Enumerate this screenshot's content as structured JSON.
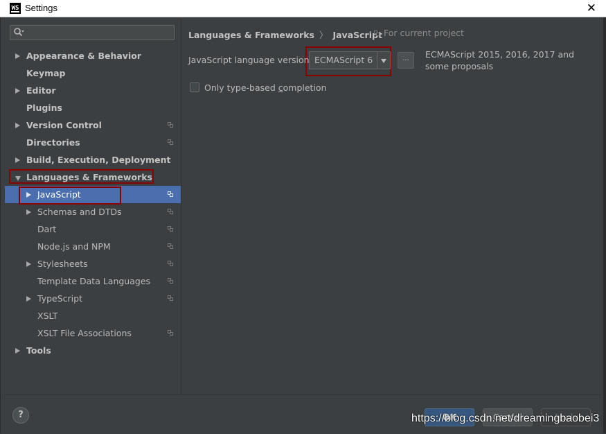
{
  "window": {
    "title": "Settings",
    "app_icon_text": "WS"
  },
  "search": {
    "placeholder": ""
  },
  "tree": [
    {
      "label": "Appearance & Behavior",
      "bold": true,
      "arrow": "right",
      "level": 0,
      "project": false
    },
    {
      "label": "Keymap",
      "bold": true,
      "arrow": "none",
      "level": 0,
      "project": false
    },
    {
      "label": "Editor",
      "bold": true,
      "arrow": "right",
      "level": 0,
      "project": false
    },
    {
      "label": "Plugins",
      "bold": true,
      "arrow": "none",
      "level": 0,
      "project": false
    },
    {
      "label": "Version Control",
      "bold": true,
      "arrow": "right",
      "level": 0,
      "project": true
    },
    {
      "label": "Directories",
      "bold": true,
      "arrow": "none",
      "level": 0,
      "project": true
    },
    {
      "label": "Build, Execution, Deployment",
      "bold": true,
      "arrow": "right",
      "level": 0,
      "project": false
    },
    {
      "label": "Languages & Frameworks",
      "bold": true,
      "arrow": "down",
      "level": 0,
      "project": false
    },
    {
      "label": "JavaScript",
      "bold": false,
      "arrow": "right",
      "level": 1,
      "project": true,
      "selected": true
    },
    {
      "label": "Schemas and DTDs",
      "bold": false,
      "arrow": "right",
      "level": 1,
      "project": true
    },
    {
      "label": "Dart",
      "bold": false,
      "arrow": "none",
      "level": 1,
      "project": true
    },
    {
      "label": "Node.js and NPM",
      "bold": false,
      "arrow": "none",
      "level": 1,
      "project": true
    },
    {
      "label": "Stylesheets",
      "bold": false,
      "arrow": "right",
      "level": 1,
      "project": true
    },
    {
      "label": "Template Data Languages",
      "bold": false,
      "arrow": "none",
      "level": 1,
      "project": true
    },
    {
      "label": "TypeScript",
      "bold": false,
      "arrow": "right",
      "level": 1,
      "project": true
    },
    {
      "label": "XSLT",
      "bold": false,
      "arrow": "none",
      "level": 1,
      "project": false
    },
    {
      "label": "XSLT File Associations",
      "bold": false,
      "arrow": "none",
      "level": 1,
      "project": true
    },
    {
      "label": "Tools",
      "bold": true,
      "arrow": "right",
      "level": 0,
      "project": false
    }
  ],
  "breadcrumb": {
    "parent": "Languages & Frameworks",
    "separator": "〉",
    "current": "JavaScript"
  },
  "scope_note": "For current project",
  "language_version": {
    "label": "JavaScript language version",
    "selected": "ECMAScript 6",
    "more_button": "...",
    "description": "ECMAScript 2015, 2016, 2017 and some proposals"
  },
  "completion_checkbox": {
    "label_before": "Only type-based ",
    "label_mnemonic": "c",
    "label_after": "ompletion",
    "checked": false
  },
  "footer": {
    "help": "?",
    "ok": "OK",
    "cancel": "Cancel",
    "apply": "Apply"
  },
  "watermark": "https://blog.csdn.net/dreamingbaobei3",
  "colors": {
    "selection": "#4b6eaf",
    "highlight_box": "#8b0000",
    "background": "#3c3f41"
  }
}
